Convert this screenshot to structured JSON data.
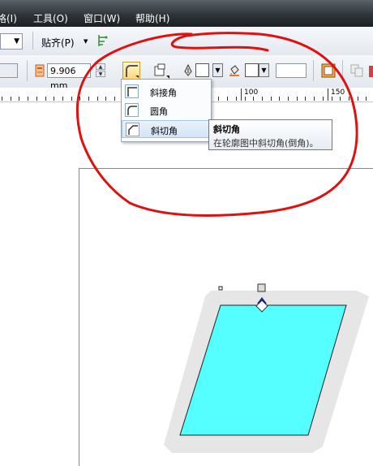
{
  "menubar": {
    "items": [
      "格(I)",
      "工具(O)",
      "窗口(W)",
      "帮助(H)"
    ]
  },
  "toolbar1": {
    "snap_label": "贴齐(P)",
    "snap_arrow": "▼"
  },
  "toolbar2": {
    "outline_width": "9.906 mm"
  },
  "ruler": {
    "labels": [
      "100",
      "150"
    ]
  },
  "corner_menu": {
    "items": [
      {
        "label": "斜接角",
        "icon": "miter-corner-icon"
      },
      {
        "label": "圆角",
        "icon": "round-corner-icon"
      },
      {
        "label": "斜切角",
        "icon": "bevel-corner-icon"
      }
    ],
    "selected_index": 2
  },
  "tooltip": {
    "title": "斜切角",
    "description": "在轮廓图中斜切角(倒角)。"
  },
  "colors": {
    "annotation_circle": "#e01010",
    "shape_fill": "#55ffff",
    "shape_outline": "#e6e6e6",
    "selection_handle": "#1a1aa0"
  }
}
